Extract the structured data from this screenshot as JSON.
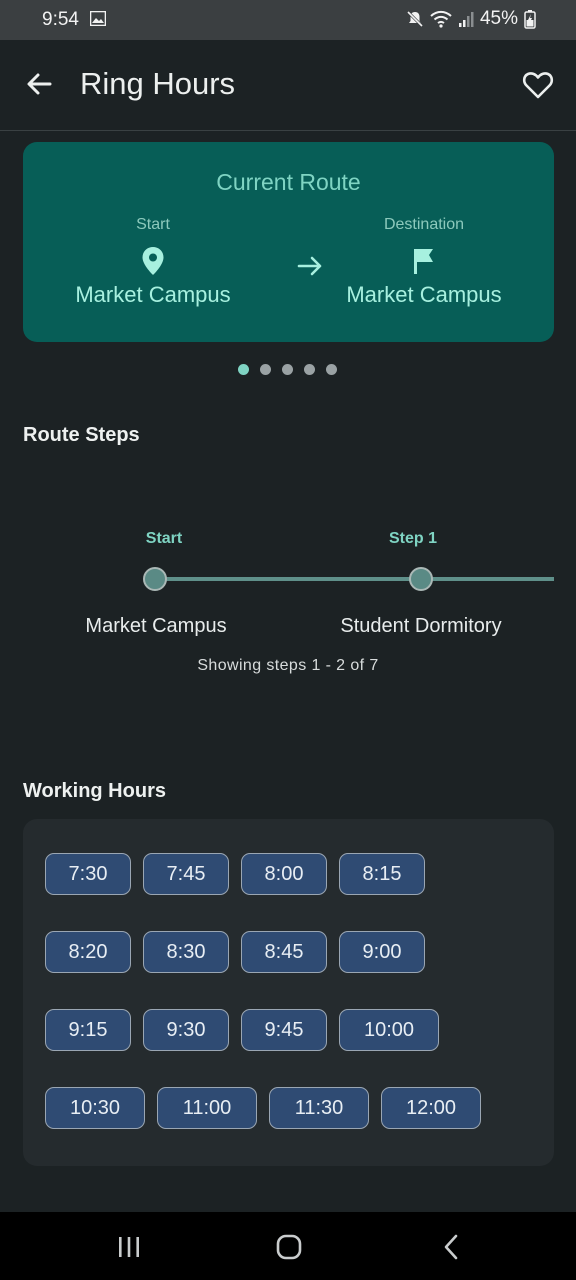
{
  "status_bar": {
    "time": "9:54",
    "battery": "45%",
    "icons": [
      "image-icon",
      "mute-icon",
      "wifi-icon",
      "signal-icon",
      "battery-icon"
    ]
  },
  "app_bar": {
    "title": "Ring Hours",
    "back_icon": "arrow-left-icon",
    "favorite_icon": "heart-outline-icon"
  },
  "route_card": {
    "title": "Current Route",
    "start_label": "Start",
    "start_place": "Market Campus",
    "start_icon": "map-pin-icon",
    "destination_label": "Destination",
    "destination_place": "Market Campus",
    "destination_icon": "flag-icon",
    "arrow_icon": "arrow-right-icon"
  },
  "pager": {
    "count": 5,
    "active_index": 0
  },
  "route_steps": {
    "title": "Route Steps",
    "steps": [
      {
        "label": "Start",
        "place": "Market Campus"
      },
      {
        "label": "Step 1",
        "place": "Student Dormitory"
      }
    ],
    "info": "Showing steps 1 - 2 of 7"
  },
  "working_hours": {
    "title": "Working Hours",
    "rows": [
      [
        "7:30",
        "7:45",
        "8:00",
        "8:15"
      ],
      [
        "8:20",
        "8:30",
        "8:45",
        "9:00"
      ],
      [
        "9:15",
        "9:30",
        "9:45",
        "10:00"
      ],
      [
        "10:30",
        "11:00",
        "11:30",
        "12:00"
      ]
    ]
  },
  "colors": {
    "background": "#1c2224",
    "accent": "#7fd4c3",
    "card": "#075e57",
    "chip": "#2f4b73"
  },
  "nav_bar": {
    "icons": [
      "recent-apps-icon",
      "home-icon",
      "back-icon"
    ]
  }
}
